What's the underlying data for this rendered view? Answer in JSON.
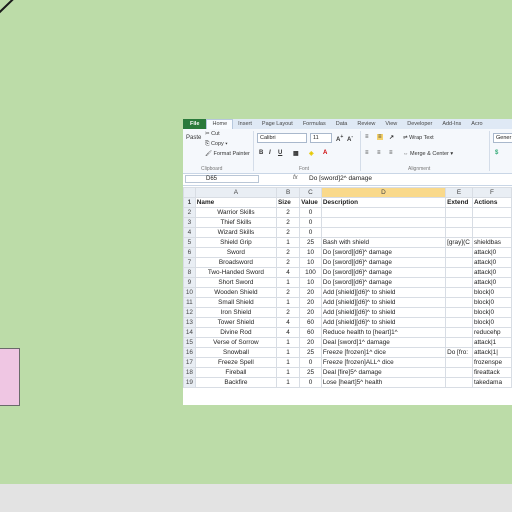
{
  "ribbon": {
    "tabs": [
      "File",
      "Home",
      "Insert",
      "Page Layout",
      "Formulas",
      "Data",
      "Review",
      "View",
      "Developer",
      "Add-Ins",
      "Acro"
    ],
    "clipboard": {
      "cut": "Cut",
      "copy": "Copy ▾",
      "format_painter": "Format Painter",
      "paste": "Paste",
      "group": "Clipboard"
    },
    "font": {
      "name": "Calibri",
      "size": "11",
      "group": "Font"
    },
    "alignment": {
      "wrap": "Wrap Text",
      "merge": "Merge & Center ▾",
      "group": "Alignment"
    },
    "number": {
      "format": "Gener"
    }
  },
  "formula_bar": {
    "name_box": "D65",
    "fx": "fx",
    "formula": "Do [sword]2^ damage"
  },
  "grid": {
    "columns": [
      "A",
      "B",
      "C",
      "D",
      "E",
      "F"
    ],
    "selected_column": "D",
    "rows": [
      {
        "n": "1",
        "a": "Name",
        "b": "Size",
        "c": "Value",
        "d": "Description",
        "e": "Extend",
        "f": "Actions"
      },
      {
        "n": "2",
        "a": "Warrior Skills",
        "b": "2",
        "c": "0",
        "d": "",
        "e": "",
        "f": ""
      },
      {
        "n": "3",
        "a": "Thief Skills",
        "b": "2",
        "c": "0",
        "d": "",
        "e": "",
        "f": ""
      },
      {
        "n": "4",
        "a": "Wizard Skills",
        "b": "2",
        "c": "0",
        "d": "",
        "e": "",
        "f": ""
      },
      {
        "n": "5",
        "a": "Shield Grip",
        "b": "1",
        "c": "25",
        "d": "Bash with shield",
        "e": "[gray](C",
        "f": "shieldbas"
      },
      {
        "n": "6",
        "a": "Sword",
        "b": "2",
        "c": "10",
        "d": "Do [sword][d6]^ damage",
        "e": "",
        "f": "attack|0"
      },
      {
        "n": "7",
        "a": "Broadsword",
        "b": "2",
        "c": "10",
        "d": "Do [sword][d6]^ damage",
        "e": "",
        "f": "attack|0"
      },
      {
        "n": "8",
        "a": "Two-Handed Sword",
        "b": "4",
        "c": "100",
        "d": "Do [sword][d6]^ damage",
        "e": "",
        "f": "attack|0"
      },
      {
        "n": "9",
        "a": "Short Sword",
        "b": "1",
        "c": "10",
        "d": "Do [sword][d6]^ damage",
        "e": "",
        "f": "attack|0"
      },
      {
        "n": "10",
        "a": "Wooden Shield",
        "b": "2",
        "c": "20",
        "d": "Add [shield][d6]^ to shield",
        "e": "",
        "f": "block|0"
      },
      {
        "n": "11",
        "a": "Small Shield",
        "b": "1",
        "c": "20",
        "d": "Add [shield][d6]^ to shield",
        "e": "",
        "f": "block|0"
      },
      {
        "n": "12",
        "a": "Iron Shield",
        "b": "2",
        "c": "20",
        "d": "Add [shield][d6]^ to shield",
        "e": "",
        "f": "block|0"
      },
      {
        "n": "13",
        "a": "Tower Shield",
        "b": "4",
        "c": "60",
        "d": "Add [shield][d6]^ to shield",
        "e": "",
        "f": "block|0"
      },
      {
        "n": "14",
        "a": "Divine Rod",
        "b": "4",
        "c": "60",
        "d": "Reduce health to [heart]1^",
        "e": "",
        "f": "reducehp"
      },
      {
        "n": "15",
        "a": "Verse of Sorrow",
        "b": "1",
        "c": "20",
        "d": "Deal [sword]1^ damage",
        "e": "",
        "f": "attack|1"
      },
      {
        "n": "16",
        "a": "Snowball",
        "b": "1",
        "c": "25",
        "d": "Freeze [frozen]1^ dice",
        "e": "Do [fro:",
        "f": "attack|1|"
      },
      {
        "n": "17",
        "a": "Freeze Spell",
        "b": "1",
        "c": "0",
        "d": "Freeze [frozen]ALL^ dice",
        "e": "",
        "f": "frozenspe"
      },
      {
        "n": "18",
        "a": "Fireball",
        "b": "1",
        "c": "25",
        "d": "Deal [fire]5^ damage",
        "e": "",
        "f": "fireattack"
      },
      {
        "n": "19",
        "a": "Backfire",
        "b": "1",
        "c": "0",
        "d": "Lose [heart]5^ health",
        "e": "",
        "f": "takedama"
      }
    ]
  },
  "colors": {
    "desk": "#bcdca8",
    "file_tab": "#2a7a3b",
    "sticky": "#efc6e3",
    "selected_header": "#f9d98b"
  }
}
